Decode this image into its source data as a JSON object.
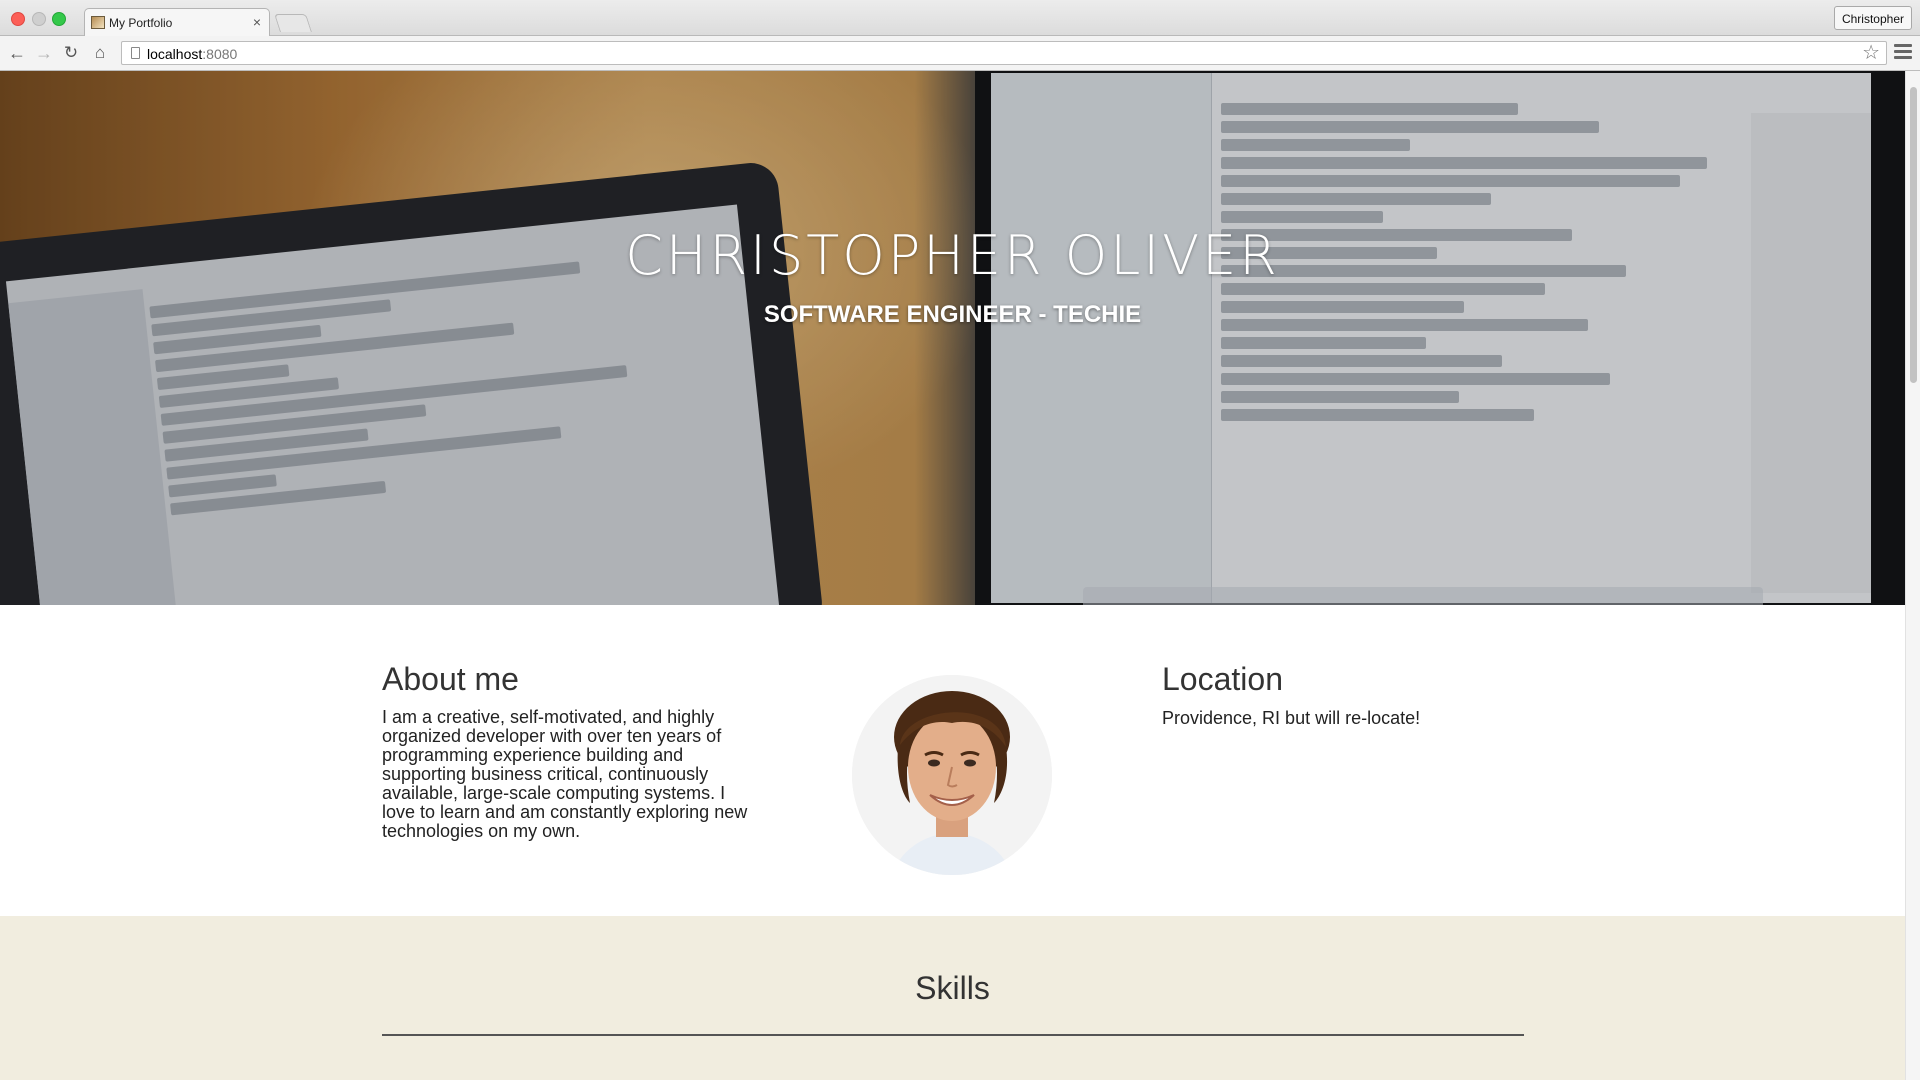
{
  "browser": {
    "tab_title": "My Portfolio",
    "tab_close": "×",
    "profile_name": "Christopher",
    "url_host": "localhost",
    "url_port": ":8080",
    "nav": {
      "back": "←",
      "forward": "→",
      "reload": "↻",
      "home": "⌂"
    },
    "star": "☆",
    "icons": {
      "back": "back-arrow-icon",
      "forward": "forward-arrow-icon",
      "reload": "reload-icon",
      "home": "home-icon",
      "bookmark": "star-icon",
      "menu": "hamburger-menu-icon"
    }
  },
  "hero": {
    "name": "CHRISTOPHER OLIVER",
    "tagline": "SOFTWARE ENGINEER - TECHIE"
  },
  "about": {
    "title": "About me",
    "text": "I am a creative, self-motivated, and highly organized developer with over ten years of programming experience building and supporting business critical, continuously available, large-scale computing systems. I love to learn and am constantly exploring new technologies on my own."
  },
  "location": {
    "title": "Location",
    "text": "Providence, RI but will re-locate!"
  },
  "skills": {
    "title": "Skills"
  },
  "colors": {
    "skills_bg": "#f1eddf",
    "heading": "#333333",
    "traffic_close": "#fc5f57",
    "traffic_max": "#34c84a"
  }
}
